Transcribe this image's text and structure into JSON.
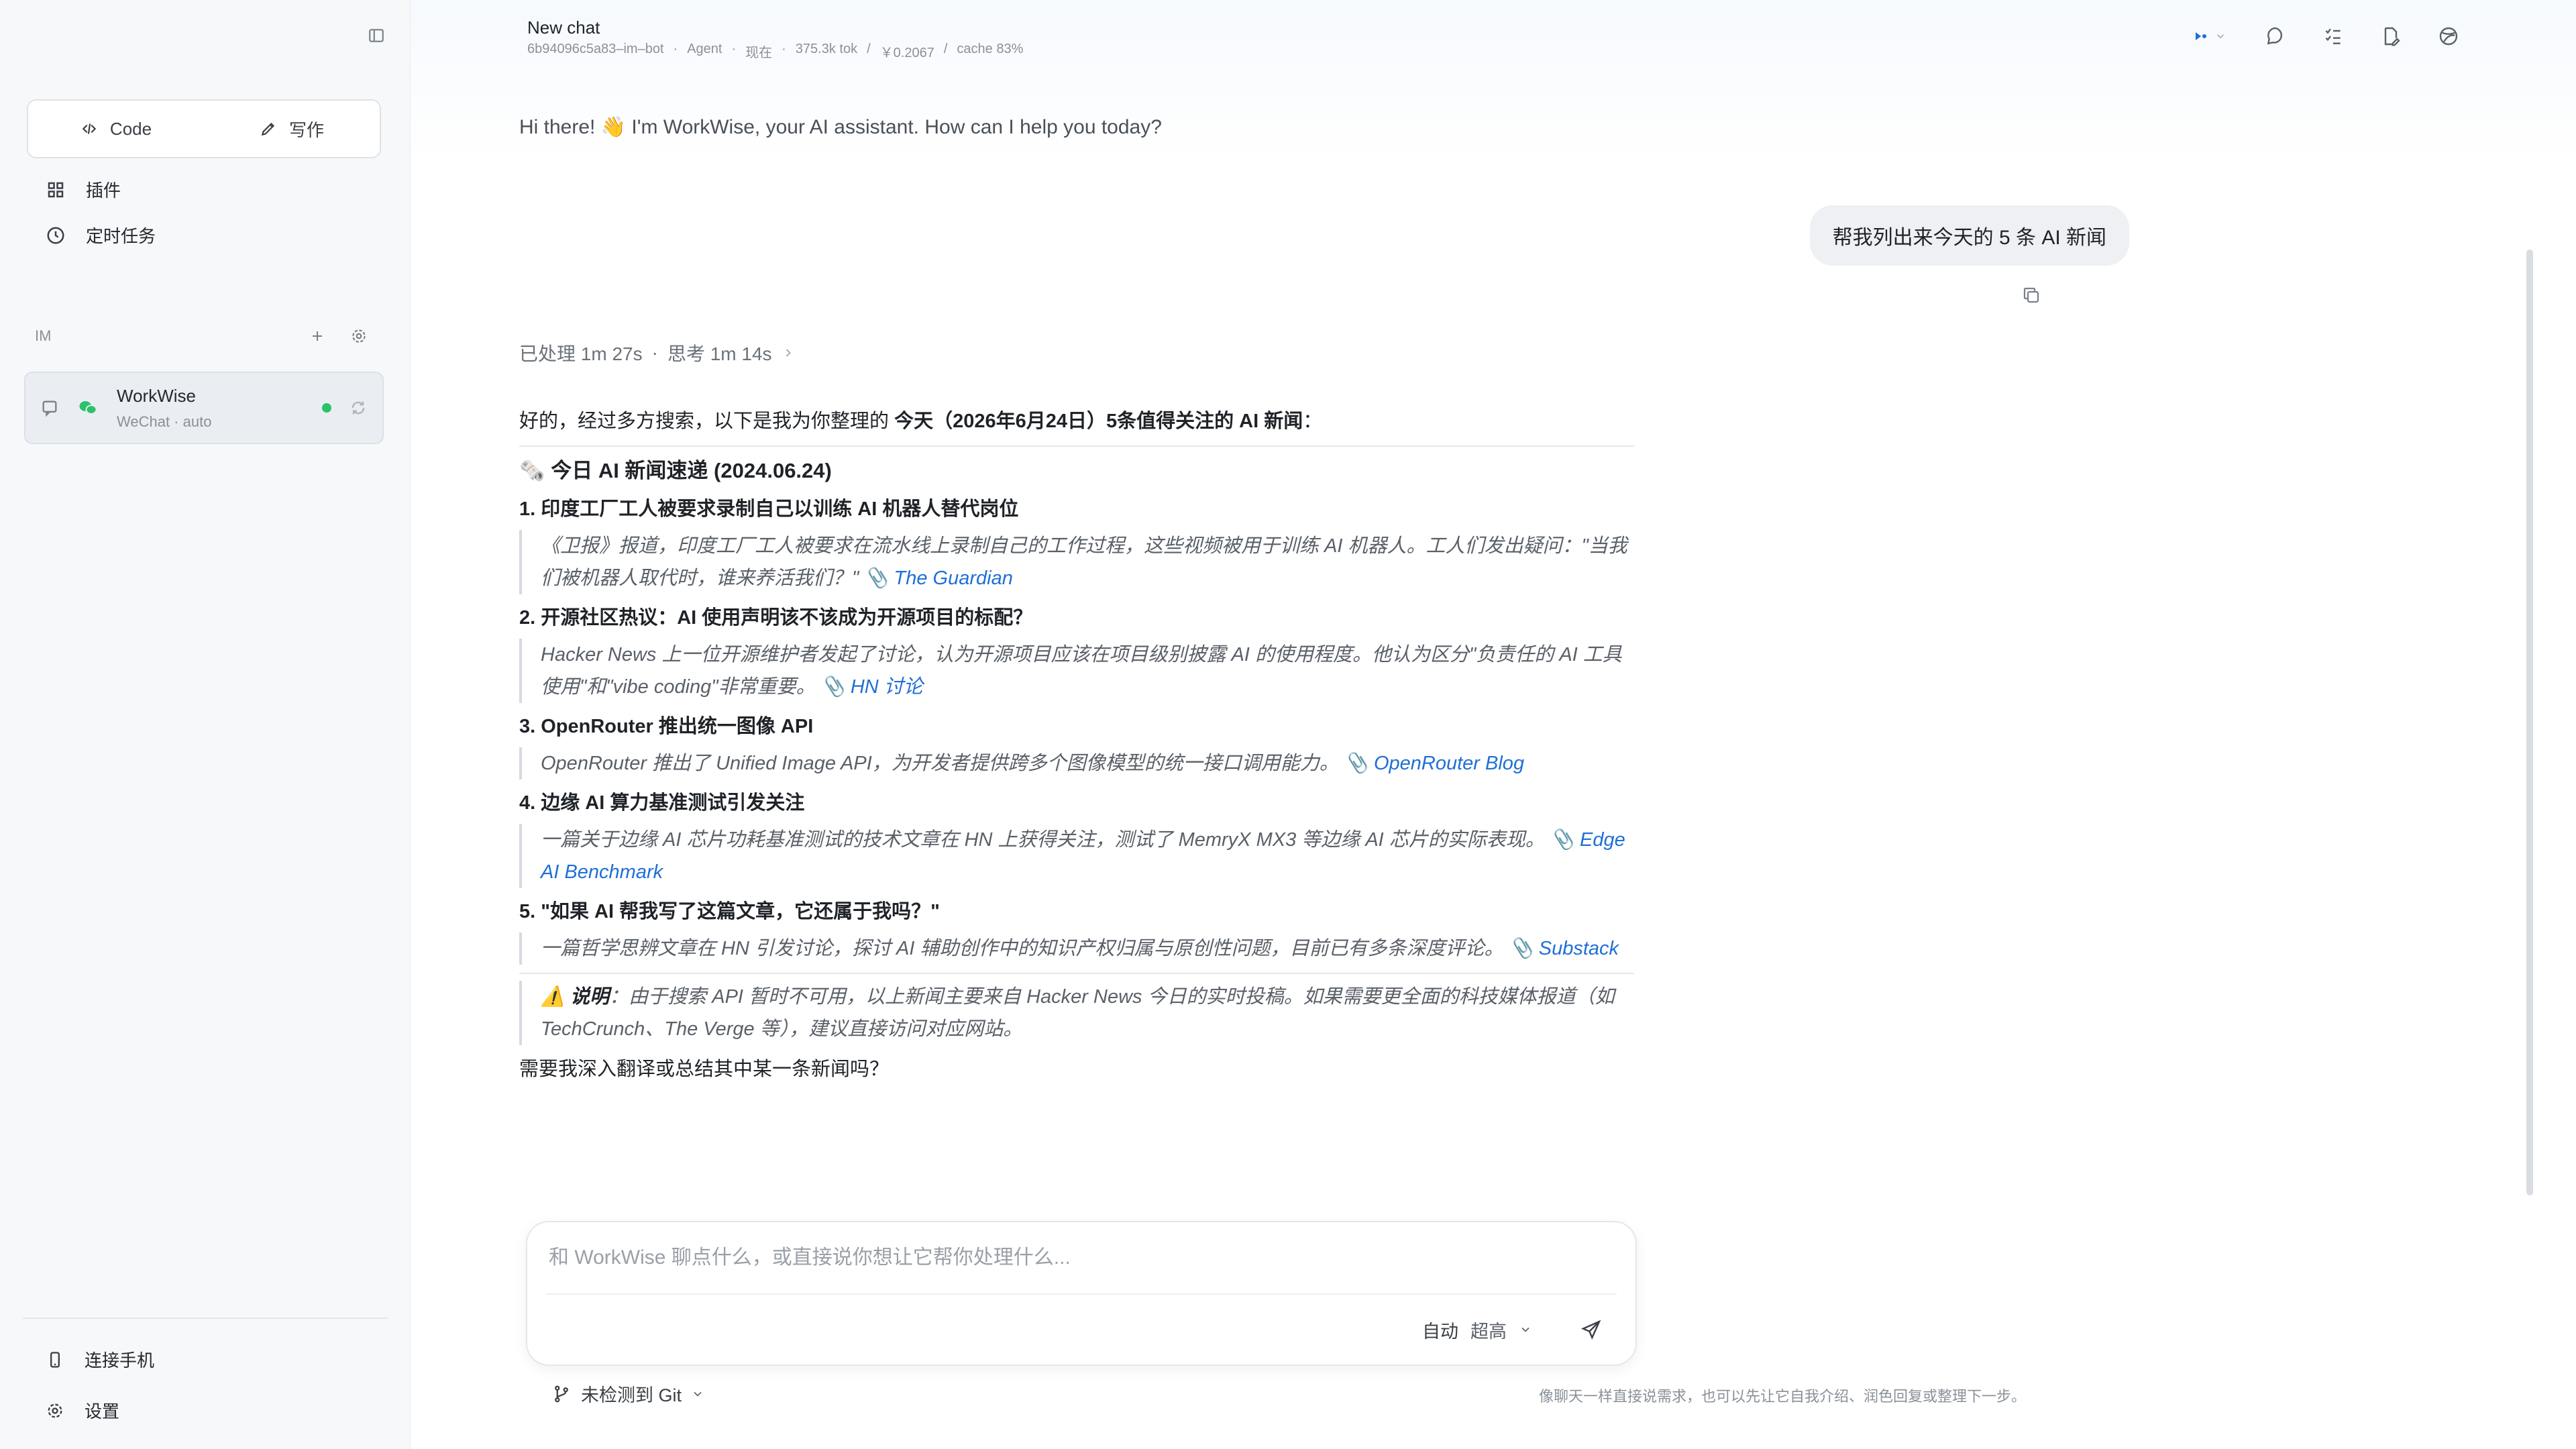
{
  "sidebar": {
    "modes": [
      {
        "label": "Code",
        "icon": "code-icon"
      },
      {
        "label": "写作",
        "icon": "pen-icon"
      }
    ],
    "nav": [
      {
        "label": "插件",
        "icon": "grid-icon"
      },
      {
        "label": "定时任务",
        "icon": "clock-icon"
      }
    ],
    "im_label": "IM",
    "bot": {
      "name": "WorkWise",
      "sub": "WeChat · auto",
      "status_color": "#2bc26a"
    },
    "footer": [
      {
        "label": "连接手机",
        "icon": "phone-icon"
      },
      {
        "label": "设置",
        "icon": "gear-icon"
      }
    ]
  },
  "header": {
    "title": "New chat",
    "meta": [
      "6b94096c5a83–im–bot",
      "·",
      "Agent",
      "·",
      "现在",
      "·",
      "375.3k tok",
      "/",
      "￥0.2067",
      "/",
      "cache 83%"
    ]
  },
  "chat": {
    "greeting": "Hi there! 👋 I'm WorkWise, your AI assistant. How can I help you today?",
    "user_message": "帮我列出来今天的 5 条 AI 新闻",
    "processed": "已处理 1m 27s",
    "dot": "·",
    "thinking": "思考 1m 14s",
    "intro_prefix": "好的，经过多方搜索，以下是我为你整理的 ",
    "intro_bold": "今天（2026年6月24日）5条值得关注的 AI 新闻",
    "intro_suffix": "：",
    "section_title": "🗞️ 今日 AI 新闻速递 (2024.06.24)",
    "items": [
      {
        "title": "1. 印度工厂工人被要求录制自己以训练 AI 机器人替代岗位",
        "body": "《卫报》报道，印度工厂工人被要求在流水线上录制自己的工作过程，这些视频被用于训练 AI 机器人。工人们发出疑问：\"当我们被机器人取代时，谁来养活我们？\" 📎",
        "link": "The Guardian"
      },
      {
        "title": "2. 开源社区热议：AI 使用声明该不该成为开源项目的标配？",
        "body": "Hacker News 上一位开源维护者发起了讨论，认为开源项目应该在项目级别披露 AI 的使用程度。他认为区分\"负责任的 AI 工具使用\"和\"vibe coding\"非常重要。 📎",
        "link": "HN 讨论"
      },
      {
        "title": "3. OpenRouter 推出统一图像 API",
        "body": "OpenRouter 推出了 Unified Image API，为开发者提供跨多个图像模型的统一接口调用能力。 📎",
        "link": "OpenRouter Blog"
      },
      {
        "title": "4. 边缘 AI 算力基准测试引发关注",
        "body": "一篇关于边缘 AI 芯片功耗基准测试的技术文章在 HN 上获得关注，测试了 MemryX MX3 等边缘 AI 芯片的实际表现。 📎",
        "link": "Edge AI Benchmark"
      },
      {
        "title": "5. \"如果 AI 帮我写了这篇文章，它还属于我吗？\"",
        "body": "一篇哲学思辨文章在 HN 引发讨论，探讨 AI 辅助创作中的知识产权归属与原创性问题，目前已有多条深度评论。 📎",
        "link": "Substack"
      }
    ],
    "warning_label": "⚠️ 说明",
    "warning_text": "：由于搜索 API 暂时不可用，以上新闻主要来自 Hacker News 今日的实时投稿。如果需要更全面的科技媒体报道（如 TechCrunch、The Verge 等），建议直接访问对应网站。",
    "closing": "需要我深入翻译或总结其中某一条新闻吗？"
  },
  "composer": {
    "placeholder": "和 WorkWise 聊点什么，或直接说你想让它帮你处理什么...",
    "mode": "自动",
    "level": "超高",
    "git": "未检测到 Git",
    "hint": "像聊天一样直接说需求，也可以先让它自我介绍、润色回复或整理下一步。"
  },
  "colors": {
    "accent": "#1f6fd6",
    "online": "#2bc26a"
  }
}
